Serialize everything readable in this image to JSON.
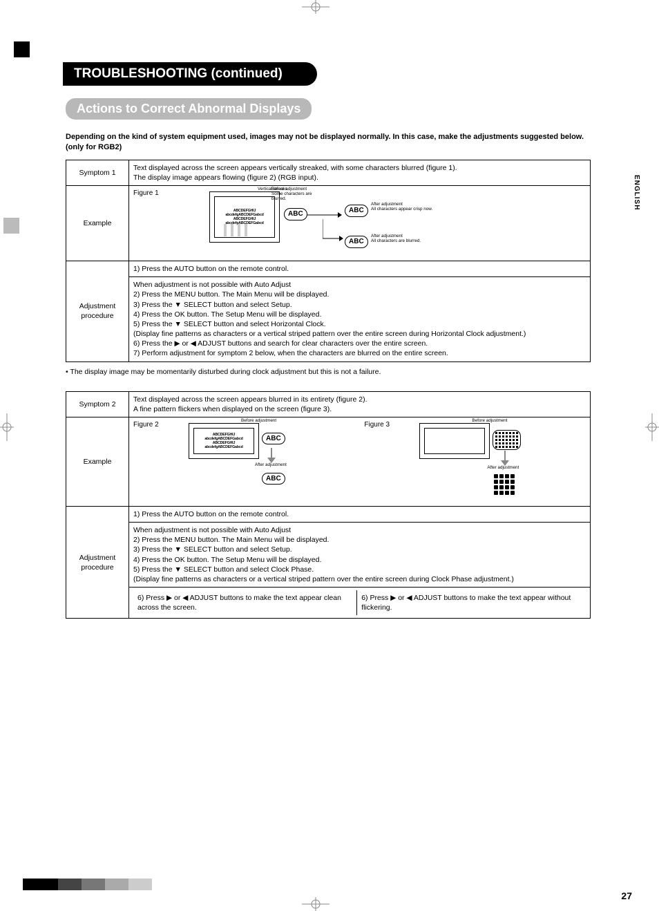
{
  "language_tab": "ENGLISH",
  "page_number": "27",
  "heading_main": "TROUBLESHOOTING (continued)",
  "heading_sub": "Actions to Correct Abnormal Displays",
  "intro": "Depending on the kind of system equipment used, images may not be displayed normally.  In this case, make the adjustments suggested below. (only for RGB2)",
  "table1": {
    "row1_label": "Symptom 1",
    "row1_text": "Text displayed across the screen appears vertically streaked, with some characters blurred (figure 1).\nThe display image appears flowing (figure 2) (RGB input).",
    "row2_label": "Example",
    "fig1_label": "Figure 1",
    "tv_line1": "ABCDEFGHIJ",
    "tv_line2": "abcdefgABCDEFGabcd",
    "tv_line3": "ABCDEFGHIJ",
    "tv_line4": "abcdefgABCDEFGabcd",
    "abc_label": "ABC",
    "ann_vstreaks": "Vertical streaks",
    "ann_before": "Before adjustment\nSome characters are blurred.",
    "ann_after1": "After adjustment\nAll characters appear crisp now.",
    "ann_after2": "After adjustment\nAll characters are blurred.",
    "row3_label": "Adjustment procedure",
    "proc_a": "1) Press the AUTO button on the remote control.",
    "proc_b": "When adjustment is not possible with Auto Adjust\n2) Press the MENU button. The Main Menu will be displayed.\n3) Press the ▼ SELECT button and select Setup.\n4) Press the OK button. The Setup Menu will be displayed.\n5) Press the ▼ SELECT button and select Horizontal Clock.\n(Display fine patterns as characters or a vertical striped pattern over the entire screen during Horizontal Clock adjustment.)\n6) Press the ▶ or ◀ ADJUST buttons and search for clear characters over the entire screen.\n7) Perform adjustment for symptom 2 below, when the characters are blurred on the entire screen."
  },
  "note": "• The display image may be momentarily disturbed during clock adjustment but this is not a failure.",
  "table2": {
    "row1_label": "Symptom 2",
    "row1_text": "Text displayed across the screen appears blurred in its entirety (figure 2).\nA fine pattern flickers when displayed on the screen (figure 3).",
    "row2_label": "Example",
    "fig2_label": "Figure 2",
    "fig3_label": "Figure 3",
    "before_label": "Before adjustment",
    "after_label": "After adjustment",
    "row3_label": "Adjustment procedure",
    "proc_a": "1) Press the AUTO button on the remote control.",
    "proc_b": "When adjustment is not possible with Auto Adjust\n2) Press the MENU button. The Main Menu will be displayed.\n3) Press the ▼ SELECT button and select Setup.\n4) Press the OK button. The Setup Menu will be displayed.\n5) Press the ▼ SELECT button and select Clock Phase.\n(Display fine patterns as characters or a vertical striped pattern over the entire screen during Clock Phase adjustment.)",
    "proc_c_left": "6) Press ▶ or ◀ ADJUST buttons to make the text appear clean across the screen.",
    "proc_c_right": "6) Press ▶ or ◀ ADJUST buttons to make the text appear without flickering."
  }
}
